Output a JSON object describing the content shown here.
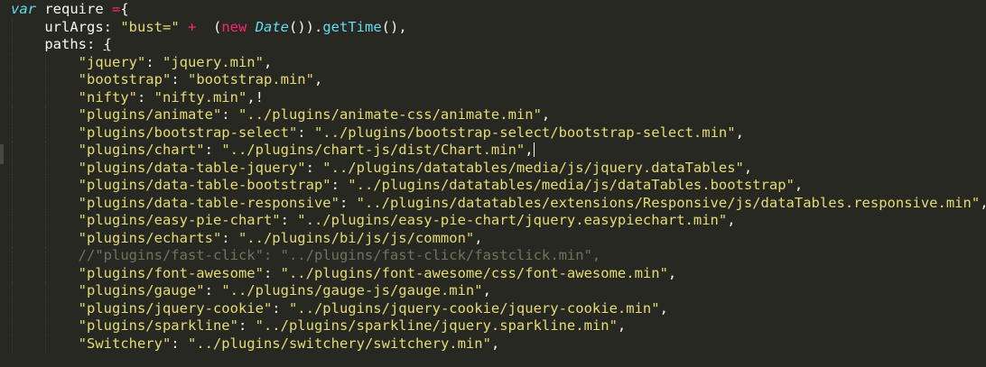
{
  "editor": {
    "line1": {
      "kw": "var",
      "ident": " require ",
      "op": "=",
      "brace": "{"
    },
    "line2": {
      "key": "urlArgs: ",
      "str": "\"bust=\"",
      "op": " + ",
      "paren": "(",
      "kw_new": "new",
      "cls": "Date",
      "rest1": "()).",
      "fn": "getTime",
      "rest2": "(),"
    },
    "line3": {
      "key": "paths: ",
      "brace": "{"
    },
    "paths": [
      {
        "key": "\"jquery\"",
        "sep": ": ",
        "val": "\"jquery.min\"",
        "tail": ","
      },
      {
        "key": "\"bootstrap\"",
        "sep": ": ",
        "val": "\"bootstrap.min\"",
        "tail": ","
      },
      {
        "key": "\"nifty\"",
        "sep": ": ",
        "val": "\"nifty.min\"",
        "tail": ",!"
      },
      {
        "key": "\"plugins/animate\"",
        "sep": ": ",
        "val": "\"../plugins/animate-css/animate.min\"",
        "tail": ","
      },
      {
        "key": "\"plugins/bootstrap-select\"",
        "sep": ": ",
        "val": "\"../plugins/bootstrap-select/bootstrap-select.min\"",
        "tail": ","
      },
      {
        "key": "\"plugins/chart\"",
        "sep": ": ",
        "val": "\"../plugins/chart-js/dist/Chart.min\"",
        "tail": ","
      },
      {
        "key": "\"plugins/data-table-jquery\"",
        "sep": ": ",
        "val": "\"../plugins/datatables/media/js/jquery.dataTables\"",
        "tail": ","
      },
      {
        "key": "\"plugins/data-table-bootstrap\"",
        "sep": ": ",
        "val": "\"../plugins/datatables/media/js/dataTables.bootstrap\"",
        "tail": ","
      },
      {
        "key": "\"plugins/data-table-responsive\"",
        "sep": ": ",
        "val": "\"../plugins/datatables/extensions/Responsive/js/dataTables.responsive.min\"",
        "tail": ","
      },
      {
        "key": "\"plugins/easy-pie-chart\"",
        "sep": ": ",
        "val": "\"../plugins/easy-pie-chart/jquery.easypiechart.min\"",
        "tail": ","
      },
      {
        "key": "\"plugins/echarts\"",
        "sep": ": ",
        "val": "\"../plugins/bi/js/js/common\"",
        "tail": ","
      },
      {
        "comment": "//\"plugins/fast-click\": \"../plugins/fast-click/fastclick.min\","
      },
      {
        "key": "\"plugins/font-awesome\"",
        "sep": ": ",
        "val": "\"../plugins/font-awesome/css/font-awesome.min\"",
        "tail": ","
      },
      {
        "key": "\"plugins/gauge\"",
        "sep": ": ",
        "val": "\"../plugins/gauge-js/gauge.min\"",
        "tail": ","
      },
      {
        "key": "\"plugins/jquery-cookie\"",
        "sep": ": ",
        "val": "\"../plugins/jquery-cookie/jquery-cookie.min\"",
        "tail": ","
      },
      {
        "key": "\"plugins/sparkline\"",
        "sep": ": ",
        "val": "\"../plugins/sparkline/jquery.sparkline.min\"",
        "tail": ","
      },
      {
        "key": "\"Switchery\"",
        "sep": ": ",
        "val": "\"../plugins/switchery/switchery.min\"",
        "tail": ","
      }
    ]
  },
  "colors": {
    "background": "#272822",
    "keyword": "#66d9ef",
    "operator": "#f92672",
    "string": "#e6db74",
    "comment": "#75715e",
    "text": "#f8f8f2"
  }
}
